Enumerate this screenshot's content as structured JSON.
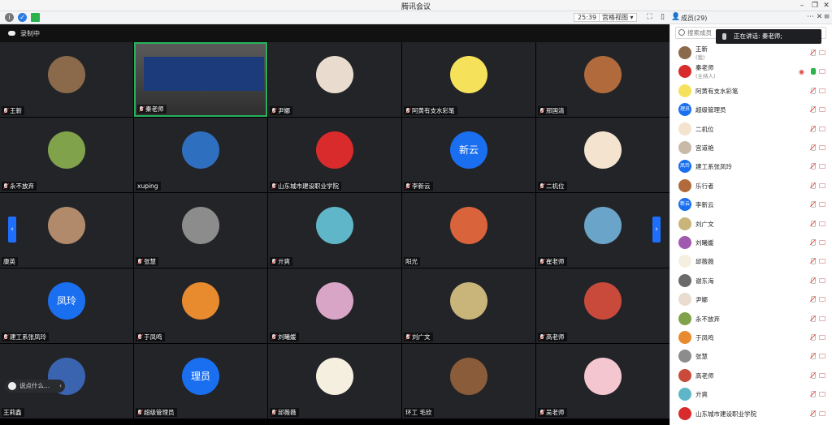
{
  "window": {
    "title": "腾讯会议"
  },
  "toolbar": {
    "timer": "25:39",
    "view_label": "宫格视图",
    "members_label": "成员(29)"
  },
  "recording": {
    "label": "录制中"
  },
  "grid": [
    {
      "name": "王新",
      "color": "#8a6a4a",
      "text": "",
      "mic": true
    },
    {
      "name": "秦老师",
      "color": "#555",
      "text": "",
      "mic": true,
      "video": true
    },
    {
      "name": "尹娜",
      "color": "#e9dccf",
      "text": "",
      "mic": true
    },
    {
      "name": "阿黄有支水彩笔",
      "color": "#f6e25a",
      "text": "",
      "mic": true
    },
    {
      "name": "邢国清",
      "color": "#b06a3b",
      "text": "",
      "mic": true
    },
    {
      "name": "永不放弃",
      "color": "#7fa24a",
      "text": "",
      "mic": true
    },
    {
      "name": "xuping",
      "color": "#2f6fbf",
      "text": "",
      "mic": false
    },
    {
      "name": "山东城市建设职业学院",
      "color": "#d92b2b",
      "text": "",
      "mic": true
    },
    {
      "name": "李新云",
      "color": "#1a6ff0",
      "text": "新云",
      "mic": true
    },
    {
      "name": "二机位",
      "color": "#f3e3cf",
      "text": "",
      "mic": true
    },
    {
      "name": "康英",
      "color": "#b08a6a",
      "text": "",
      "mic": false
    },
    {
      "name": "张慧",
      "color": "#8c8c8c",
      "text": "",
      "mic": true
    },
    {
      "name": "亓爽",
      "color": "#5fb6c8",
      "text": "",
      "mic": true
    },
    {
      "name": "阳光",
      "color": "#d9633b",
      "text": "",
      "mic": false
    },
    {
      "name": "崔老师",
      "color": "#6aa5c9",
      "text": "",
      "mic": true
    },
    {
      "name": "建工系张凤玲",
      "color": "#1a6ff0",
      "text": "凤玲",
      "mic": true
    },
    {
      "name": "于凤鸣",
      "color": "#e88a2e",
      "text": "",
      "mic": true
    },
    {
      "name": "刘曦媛",
      "color": "#d8a5c6",
      "text": "",
      "mic": true
    },
    {
      "name": "刘广文",
      "color": "#c9b47a",
      "text": "",
      "mic": true
    },
    {
      "name": "高老师",
      "color": "#c94a3b",
      "text": "",
      "mic": true
    },
    {
      "name": "王莉鑫",
      "color": "#3a64b0",
      "text": "",
      "mic": false
    },
    {
      "name": "超级管理员",
      "color": "#1a6ff0",
      "text": "理员",
      "mic": true
    },
    {
      "name": "邱薇薇",
      "color": "#f5efe0",
      "text": "",
      "mic": true
    },
    {
      "name": "环工 毛欣",
      "color": "#8a5c3a",
      "text": "",
      "mic": false
    },
    {
      "name": "吴老师",
      "color": "#f4c6d0",
      "text": "",
      "mic": true
    }
  ],
  "chat": {
    "placeholder": "说点什么..."
  },
  "sidebar": {
    "search_placeholder": "搜索成员",
    "speaking": "正在讲话: 秦老师;",
    "members": [
      {
        "name": "王新",
        "sub": "(我)",
        "color": "#8a6a4a",
        "text": ""
      },
      {
        "name": "秦老师",
        "sub": "(主持人)",
        "color": "#d92b2b",
        "text": "",
        "mic_on": true
      },
      {
        "name": "阿黄有支水彩笔",
        "color": "#f6e25a",
        "text": ""
      },
      {
        "name": "超级管理员",
        "color": "#1a6ff0",
        "text": "理员"
      },
      {
        "name": "二机位",
        "color": "#f3e3cf",
        "text": ""
      },
      {
        "name": "宫道艳",
        "color": "#c9b9a8",
        "text": ""
      },
      {
        "name": "建工系张凤玲",
        "color": "#1a6ff0",
        "text": "凤玲"
      },
      {
        "name": "乐行者",
        "color": "#b06a3b",
        "text": ""
      },
      {
        "name": "李新云",
        "color": "#1a6ff0",
        "text": "新云"
      },
      {
        "name": "刘广文",
        "color": "#c9b47a",
        "text": ""
      },
      {
        "name": "刘曦媛",
        "color": "#a05ab0",
        "text": ""
      },
      {
        "name": "邱薇薇",
        "color": "#f5efe0",
        "text": ""
      },
      {
        "name": "谢东海",
        "color": "#6a6a6a",
        "text": ""
      },
      {
        "name": "尹娜",
        "color": "#e9dccf",
        "text": ""
      },
      {
        "name": "永不放弃",
        "color": "#7fa24a",
        "text": ""
      },
      {
        "name": "于凤鸣",
        "color": "#e88a2e",
        "text": ""
      },
      {
        "name": "张慧",
        "color": "#8c8c8c",
        "text": ""
      },
      {
        "name": "高老师",
        "color": "#c94a3b",
        "text": ""
      },
      {
        "name": "亓爽",
        "color": "#5fb6c8",
        "text": ""
      },
      {
        "name": "山东城市建设职业学院",
        "color": "#d92b2b",
        "text": ""
      }
    ]
  }
}
